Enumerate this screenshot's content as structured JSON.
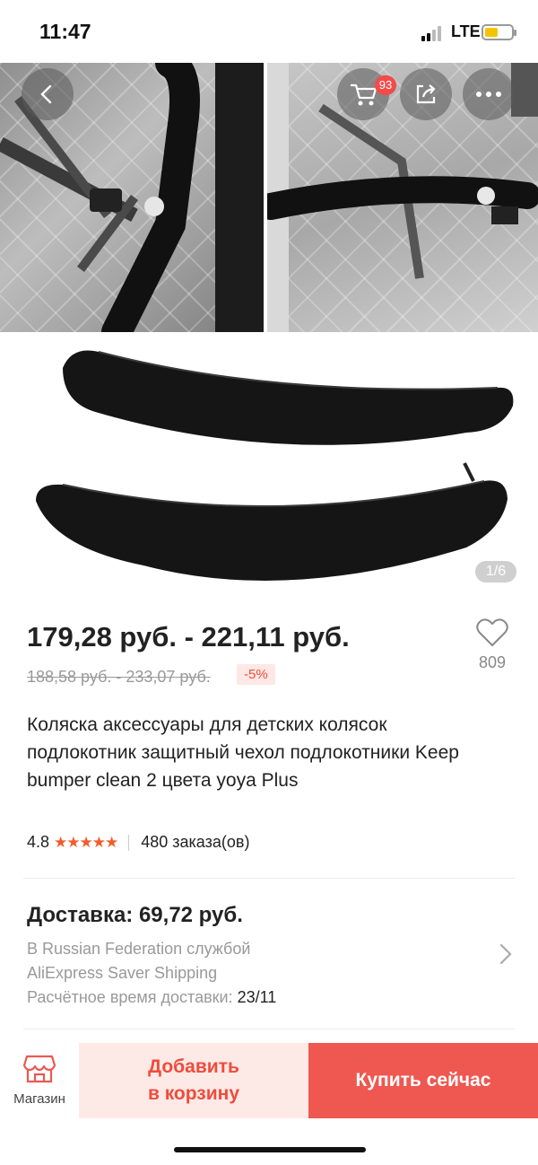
{
  "status_bar": {
    "time": "11:47",
    "network": "LTE"
  },
  "gallery": {
    "page_indicator": "1/6",
    "cart_count": "93"
  },
  "product": {
    "price": "179,28 руб. - 221,11 руб.",
    "old_price": "188,58 руб. - 233,07 руб.",
    "discount": "-5%",
    "wishlist_count": "809",
    "title": "Коляска аксессуары для детских колясок подлокотник защитный чехол подлокотники Keep bumper clean 2 цвета yoya Plus",
    "rating": "4.8",
    "stars": "★★★★★",
    "orders": "480 заказа(ов)"
  },
  "delivery": {
    "title": "Доставка: 69,72 руб.",
    "line1": "В Russian Federation службой",
    "line2": "AliExpress Saver Shipping",
    "eta_label": "Расчётное время доставки: ",
    "eta_date": "23/11"
  },
  "bottom_bar": {
    "store_label": "Магазин",
    "add_to_cart_line1": "Добавить",
    "add_to_cart_line2": "в корзину",
    "buy_now": "Купить сейчас"
  },
  "colors": {
    "accent": "#ee5850",
    "accent_light": "#fde9e6",
    "star": "#f25c2c"
  }
}
